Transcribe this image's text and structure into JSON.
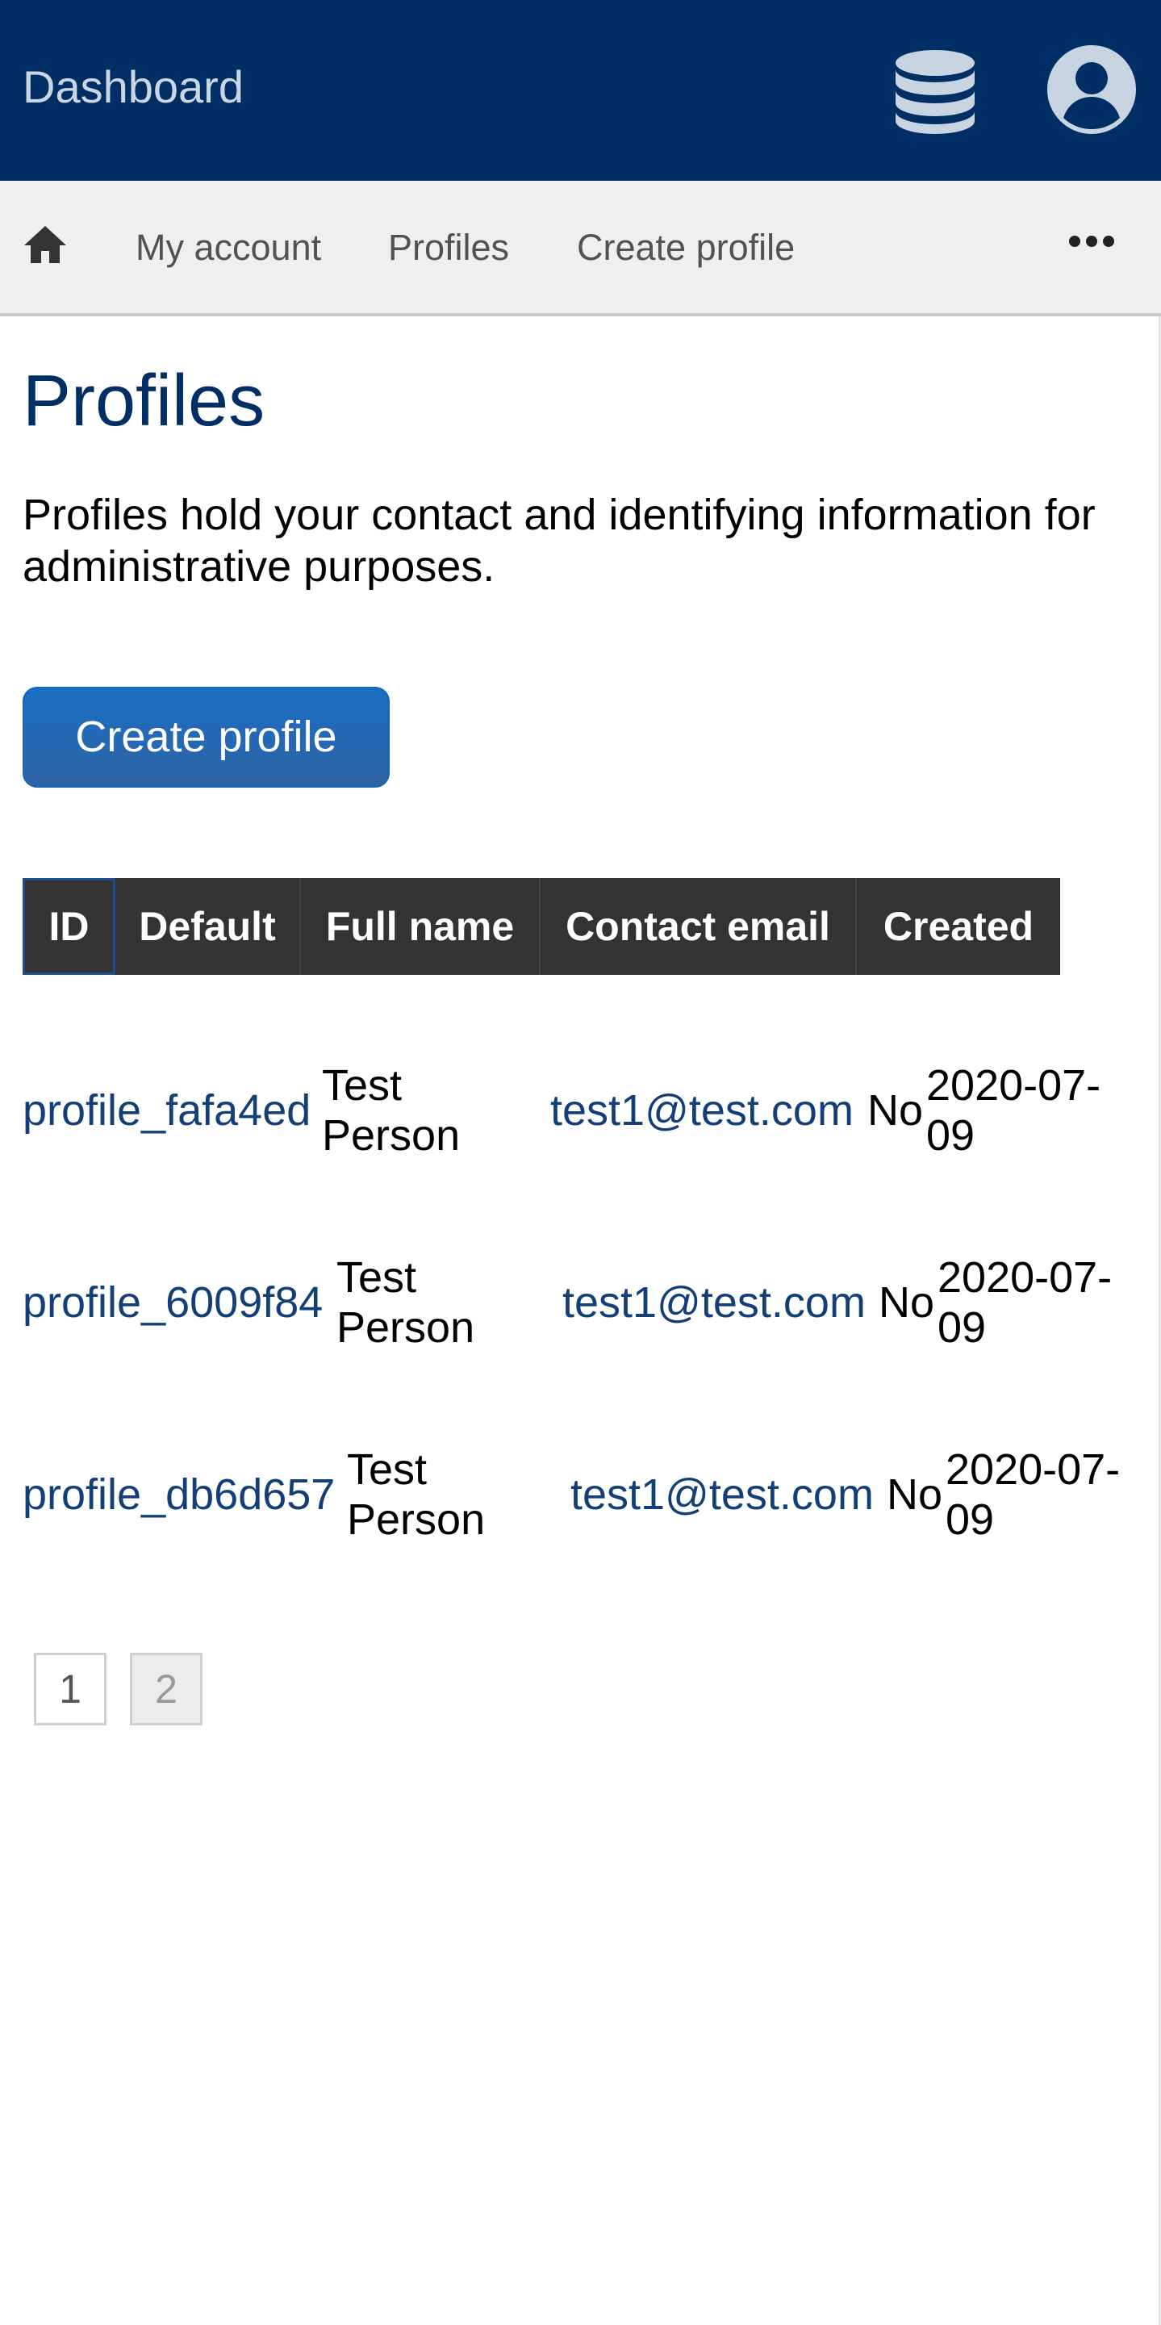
{
  "header": {
    "app_title": "Dashboard",
    "icons": [
      "database-icon",
      "user-icon"
    ]
  },
  "nav": {
    "home_icon": "home-icon",
    "items": [
      {
        "label": "My account"
      },
      {
        "label": "Profiles"
      },
      {
        "label": "Create profile"
      }
    ],
    "more_icon": "ellipsis-icon"
  },
  "main": {
    "title": "Profiles",
    "intro": "Profiles hold your contact and identifying information for administrative purposes.",
    "create_button": "Create profile"
  },
  "table": {
    "columns": [
      "ID",
      "Default",
      "Full name",
      "Contact email",
      "Created"
    ],
    "rows": [
      {
        "id": "profile_fafa4ed",
        "full_name_line1": "Test",
        "full_name_line2": "Person",
        "email": "test1@test.com",
        "default": "No",
        "created_line1": "2020-07-",
        "created_line2": "09"
      },
      {
        "id": "profile_6009f84",
        "full_name_line1": "Test",
        "full_name_line2": "Person",
        "email": "test1@test.com",
        "default": "No",
        "created_line1": "2020-07-",
        "created_line2": "09"
      },
      {
        "id": "profile_db6d657",
        "full_name_line1": "Test",
        "full_name_line2": "Person",
        "email": "test1@test.com",
        "default": "No",
        "created_line1": "2020-07-",
        "created_line2": "09"
      }
    ]
  },
  "pagination": {
    "pages": [
      "1",
      "2"
    ],
    "current": "1"
  },
  "colors": {
    "header_bg": "#002f66",
    "nav_bg": "#efefef",
    "accent": "#1a6fc6",
    "link": "#123f78",
    "table_header_bg": "#333333"
  }
}
